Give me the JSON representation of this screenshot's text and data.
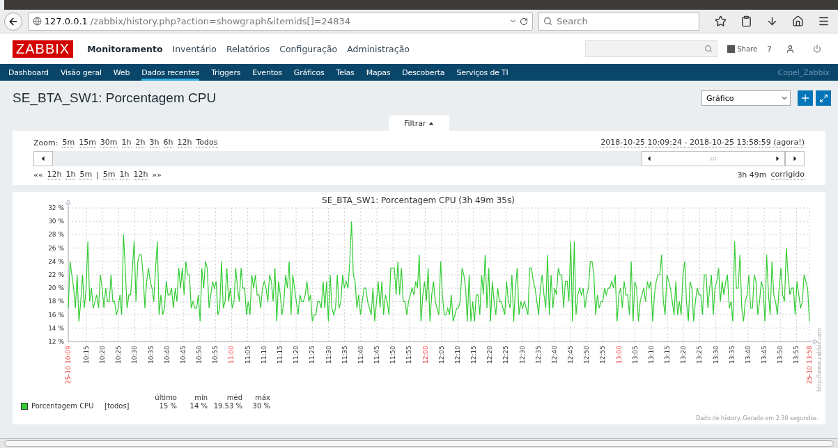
{
  "browser": {
    "url_host": "127.0.0.1",
    "url_path": "/zabbix/history.php?action=showgraph&itemids[]=24834",
    "search_placeholder": "Search"
  },
  "header": {
    "logo": "ZABBIX",
    "menu": [
      {
        "label": "Monitoramento",
        "selected": true
      },
      {
        "label": "Inventário",
        "selected": false
      },
      {
        "label": "Relatórios",
        "selected": false
      },
      {
        "label": "Configuração",
        "selected": false
      },
      {
        "label": "Administração",
        "selected": false
      }
    ],
    "share": "Share",
    "help": "?"
  },
  "subnav": {
    "items": [
      {
        "label": "Dashboard",
        "selected": false
      },
      {
        "label": "Visão geral",
        "selected": false
      },
      {
        "label": "Web",
        "selected": false
      },
      {
        "label": "Dados recentes",
        "selected": true
      },
      {
        "label": "Triggers",
        "selected": false
      },
      {
        "label": "Eventos",
        "selected": false
      },
      {
        "label": "Gráficos",
        "selected": false
      },
      {
        "label": "Telas",
        "selected": false
      },
      {
        "label": "Mapas",
        "selected": false
      },
      {
        "label": "Descoberta",
        "selected": false
      },
      {
        "label": "Serviços de TI",
        "selected": false
      }
    ],
    "user": "Copel_Zabbix"
  },
  "page": {
    "title": "SE_BTA_SW1: Porcentagem CPU",
    "view_select": "Gráfico"
  },
  "filter": {
    "tab": "Filtrar",
    "zoom_label": "Zoom:",
    "zoom_links": [
      "5m",
      "15m",
      "30m",
      "1h",
      "2h",
      "3h",
      "6h",
      "12h",
      "Todos"
    ],
    "range": "2018-10-25 10:09:24 - 2018-10-25 13:58:59 (agora!)",
    "back_mark": "««",
    "back_links": [
      "12h",
      "1h",
      "5m"
    ],
    "separator": "|",
    "forward_links": [
      "5m",
      "1h",
      "12h"
    ],
    "forward_mark": "»»",
    "duration": "3h 49m",
    "fixed": "corrigido"
  },
  "graph": {
    "chart_data": {
      "type": "line",
      "title": "SE_BTA_SW1: Porcentagem CPU (3h 49m 35s)",
      "grid": true,
      "ylim": [
        12,
        32
      ],
      "yticks": [
        {
          "value": 12,
          "label": "12 %"
        },
        {
          "value": 14,
          "label": "14 %"
        },
        {
          "value": 16,
          "label": "16 %"
        },
        {
          "value": 18,
          "label": "18 %"
        },
        {
          "value": 20,
          "label": "20 %"
        },
        {
          "value": 22,
          "label": "22 %"
        },
        {
          "value": 24,
          "label": "24 %"
        },
        {
          "value": 26,
          "label": "26 %"
        },
        {
          "value": 28,
          "label": "28 %"
        },
        {
          "value": 30,
          "label": "30 %"
        },
        {
          "value": 32,
          "label": "32 %"
        }
      ],
      "series": [
        {
          "name": "Porcentagem CPU",
          "color": "#33cc33",
          "values": [
            17,
            24,
            22,
            20,
            17,
            22,
            15,
            18,
            22,
            17,
            20,
            27,
            18,
            20,
            17,
            18,
            19,
            17,
            22,
            20,
            17,
            20,
            18,
            18,
            22,
            18,
            18,
            16,
            17,
            19,
            16,
            28,
            23,
            17,
            19,
            19,
            23,
            27,
            18,
            24,
            25,
            25,
            22,
            17,
            21,
            23,
            21,
            20,
            18,
            23,
            27,
            16,
            19,
            16,
            17,
            21,
            19,
            19,
            20,
            17,
            20,
            18,
            23,
            20,
            23,
            19,
            24,
            22,
            22,
            17,
            18,
            17,
            17,
            19,
            15,
            23,
            20,
            24,
            23,
            17,
            19,
            21,
            20,
            21,
            16,
            17,
            24,
            17,
            18,
            23,
            18,
            20,
            17,
            18,
            23,
            20,
            18,
            23,
            20,
            20,
            16,
            18,
            16,
            22,
            20,
            22,
            19,
            19,
            17,
            20,
            21,
            20,
            18,
            22,
            21,
            18,
            23,
            15,
            21,
            19,
            16,
            18,
            22,
            20,
            24,
            16,
            22,
            20,
            18,
            16,
            19,
            18,
            18,
            19,
            21,
            18,
            19,
            15,
            16,
            16,
            18,
            18,
            17,
            21,
            17,
            21,
            15,
            22,
            17,
            16,
            17,
            22,
            17,
            18,
            22,
            20,
            21,
            20,
            24,
            30,
            22,
            21,
            17,
            19,
            16,
            18,
            20,
            20,
            18,
            17,
            16,
            20,
            15,
            18,
            21,
            17,
            21,
            16,
            19,
            18,
            16,
            23,
            23,
            23,
            19,
            24,
            19,
            23,
            18,
            18,
            16,
            18,
            19,
            20,
            19,
            21,
            20,
            25,
            15,
            19,
            21,
            18,
            23,
            15,
            19,
            21,
            18,
            17,
            16,
            24,
            19,
            16,
            16,
            17,
            16,
            19,
            15,
            16,
            17,
            17,
            18,
            23,
            22,
            20,
            15,
            22,
            15,
            18,
            15,
            19,
            19,
            16,
            22,
            19,
            25,
            17,
            23,
            15,
            21,
            18,
            16,
            20,
            18,
            18,
            17,
            16,
            21,
            18,
            17,
            22,
            15,
            20,
            23,
            16,
            18,
            17,
            18,
            17,
            16,
            23,
            23,
            21,
            20,
            18,
            16,
            20,
            22,
            19,
            17,
            25,
            16,
            22,
            17,
            20,
            19,
            23,
            22,
            22,
            17,
            21,
            21,
            18,
            27,
            15,
            27,
            16,
            19,
            20,
            19,
            20,
            17,
            19,
            20,
            24,
            24,
            22,
            16,
            19,
            17,
            18,
            18,
            20,
            19,
            20,
            20,
            21,
            20,
            22,
            15,
            19,
            20,
            17,
            21,
            19,
            19,
            16,
            24,
            15,
            21,
            20,
            15,
            18,
            19,
            20,
            18,
            21,
            20,
            21,
            15,
            19,
            21,
            22,
            22,
            25,
            18,
            16,
            22,
            21,
            20,
            18,
            16,
            21,
            16,
            18,
            16,
            22,
            24,
            18,
            15,
            21,
            20,
            15,
            18,
            20,
            19,
            19,
            16,
            22,
            22,
            17,
            20,
            22,
            16,
            20,
            21,
            23,
            18,
            21,
            19,
            21,
            22,
            17,
            18,
            15,
            27,
            20,
            20,
            25,
            17,
            15,
            18,
            19,
            22,
            17,
            17,
            22,
            21,
            16,
            18,
            21,
            20,
            15,
            25,
            19,
            16,
            24,
            19,
            18,
            16,
            20,
            23,
            19,
            18,
            26,
            22,
            19,
            20,
            20,
            16,
            21,
            19,
            17,
            18,
            22,
            21,
            20,
            15
          ]
        }
      ]
    },
    "time_labels": [
      {
        "label": "25-10 10:09",
        "highlight": true
      },
      {
        "label": "10:15",
        "highlight": false
      },
      {
        "label": "10:20",
        "highlight": false
      },
      {
        "label": "10:25",
        "highlight": false
      },
      {
        "label": "10:30",
        "highlight": false
      },
      {
        "label": "10:35",
        "highlight": false
      },
      {
        "label": "10:40",
        "highlight": false
      },
      {
        "label": "10:45",
        "highlight": false
      },
      {
        "label": "10:50",
        "highlight": false
      },
      {
        "label": "10:55",
        "highlight": false
      },
      {
        "label": "11:00",
        "highlight": true
      },
      {
        "label": "11:05",
        "highlight": false
      },
      {
        "label": "11:10",
        "highlight": false
      },
      {
        "label": "11:15",
        "highlight": false
      },
      {
        "label": "11:20",
        "highlight": false
      },
      {
        "label": "11:25",
        "highlight": false
      },
      {
        "label": "11:30",
        "highlight": false
      },
      {
        "label": "11:35",
        "highlight": false
      },
      {
        "label": "11:40",
        "highlight": false
      },
      {
        "label": "11:45",
        "highlight": false
      },
      {
        "label": "11:50",
        "highlight": false
      },
      {
        "label": "11:55",
        "highlight": false
      },
      {
        "label": "12:00",
        "highlight": true
      },
      {
        "label": "12:05",
        "highlight": false
      },
      {
        "label": "12:10",
        "highlight": false
      },
      {
        "label": "12:15",
        "highlight": false
      },
      {
        "label": "12:20",
        "highlight": false
      },
      {
        "label": "12:25",
        "highlight": false
      },
      {
        "label": "12:30",
        "highlight": false
      },
      {
        "label": "12:35",
        "highlight": false
      },
      {
        "label": "12:40",
        "highlight": false
      },
      {
        "label": "12:45",
        "highlight": false
      },
      {
        "label": "12:50",
        "highlight": false
      },
      {
        "label": "12:55",
        "highlight": false
      },
      {
        "label": "13:00",
        "highlight": true
      },
      {
        "label": "13:05",
        "highlight": false
      },
      {
        "label": "13:10",
        "highlight": false
      },
      {
        "label": "13:15",
        "highlight": false
      },
      {
        "label": "13:20",
        "highlight": false
      },
      {
        "label": "13:25",
        "highlight": false
      },
      {
        "label": "13:30",
        "highlight": false
      },
      {
        "label": "13:35",
        "highlight": false
      },
      {
        "label": "13:40",
        "highlight": false
      },
      {
        "label": "13:45",
        "highlight": false
      },
      {
        "label": "13:50",
        "highlight": false
      },
      {
        "label": "13:55",
        "highlight": false
      },
      {
        "label": "25-10 13:58",
        "highlight": true
      }
    ],
    "legend": {
      "headers": [
        "último",
        "mín",
        "méd",
        "máx"
      ],
      "items": [
        {
          "scope": "[todos]",
          "stats": [
            "15 %",
            "14 %",
            "19.53 %",
            "30 %"
          ]
        }
      ]
    },
    "credit": "http://www.zabbix.com",
    "footer": "Dado de history. Gerado em 2.30 segundos."
  }
}
